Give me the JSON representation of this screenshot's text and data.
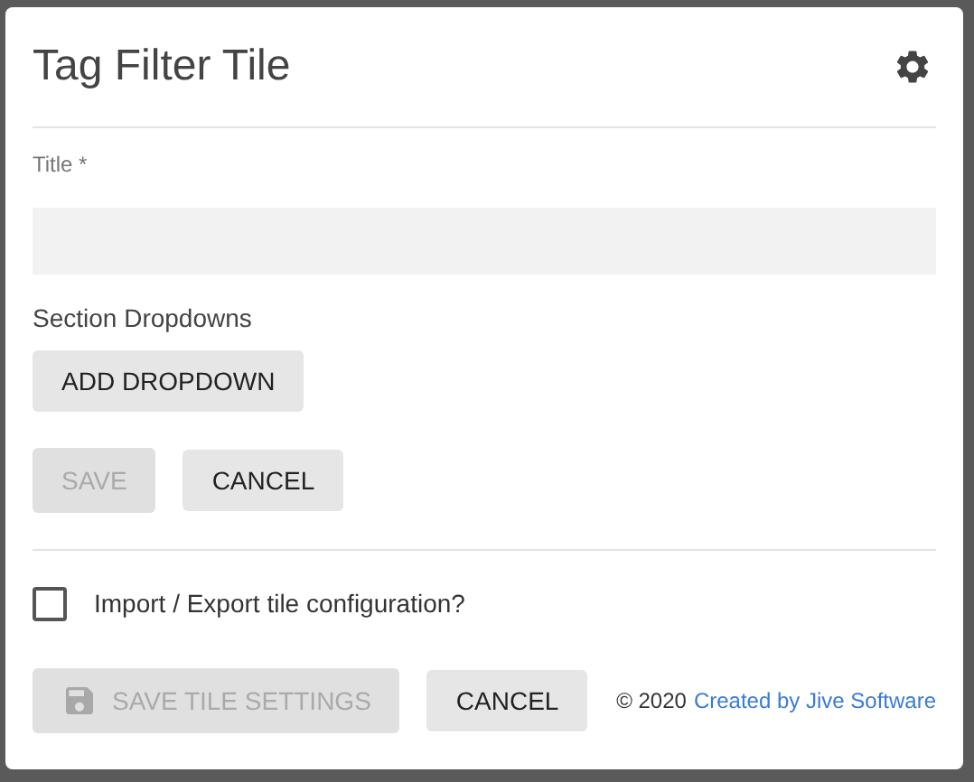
{
  "dialog": {
    "title": "Tag Filter Tile"
  },
  "title_field": {
    "label": "Title *"
  },
  "section": {
    "label": "Section Dropdowns",
    "add_button": {
      "label": "ADD DROPDOWN",
      "disabled": false
    }
  },
  "form_buttons": [
    {
      "label": "SAVE",
      "disabled": true
    },
    {
      "label": "CANCEL",
      "disabled": false
    }
  ],
  "import_export": {
    "label": "Import / Export tile configuration?",
    "checked": false
  },
  "footer_buttons": [
    {
      "label": "SAVE TILE SETTINGS",
      "disabled": true,
      "kind": "iconed"
    },
    {
      "label": "CANCEL",
      "disabled": false,
      "kind": "plain"
    }
  ],
  "footer": {
    "copyright": "© 2020",
    "link": "Created by Jive Software"
  }
}
